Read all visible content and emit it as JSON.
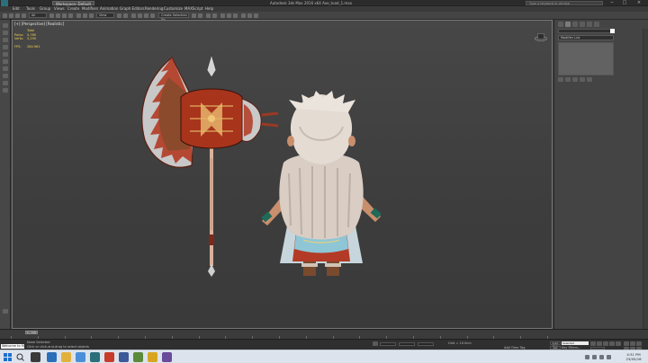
{
  "title_bar": {
    "workspace": "Workspace: Default",
    "window_title": "Autodesk 3ds Max 2016 x64    Axe_toad_1.max",
    "search_placeholder": "Type a keyword or phrase",
    "minimize": "−",
    "maximize": "□",
    "close": "×"
  },
  "menu": [
    "Edit",
    "Tools",
    "Group",
    "Views",
    "Create",
    "Modifiers",
    "Animation",
    "Graph Editors",
    "Rendering",
    "Customize",
    "MAXScript",
    "Help"
  ],
  "toolbar": {
    "selection_filter": "All",
    "reference_coord": "View",
    "named_selection": "Create Selection Se"
  },
  "viewport": {
    "label": "[+] [Perspective] [Realistic]",
    "stats": {
      "header": "Total",
      "rows": [
        {
          "label": "Polys:",
          "value": "5,780"
        },
        {
          "label": "Verts:",
          "value": "3,290"
        },
        {
          "label": "FPS:",
          "value": "284.961"
        }
      ]
    }
  },
  "command_panel": {
    "modifier_list": "Modifier List",
    "object_color": "#ffffff"
  },
  "timeline": {
    "slider": "0 / 100"
  },
  "status_bar": {
    "welcome": "Welcome to M",
    "selection": "None Selected",
    "prompt": "Click or click-and-drag to select objects",
    "grid": "Grid = 10.0cm",
    "add_time_tag": "Add Time Tag",
    "auto_key": "Auto Key",
    "set_key": "Set Key",
    "key_mode": "Selected",
    "key_filters": "Key Filters..."
  },
  "taskbar": {
    "time": "4:31 PM",
    "date": "23/05/16"
  },
  "colors": {
    "viewport_bg": "#474747",
    "stats_text": "#f2d24a",
    "accent": "#2b6f7a"
  }
}
